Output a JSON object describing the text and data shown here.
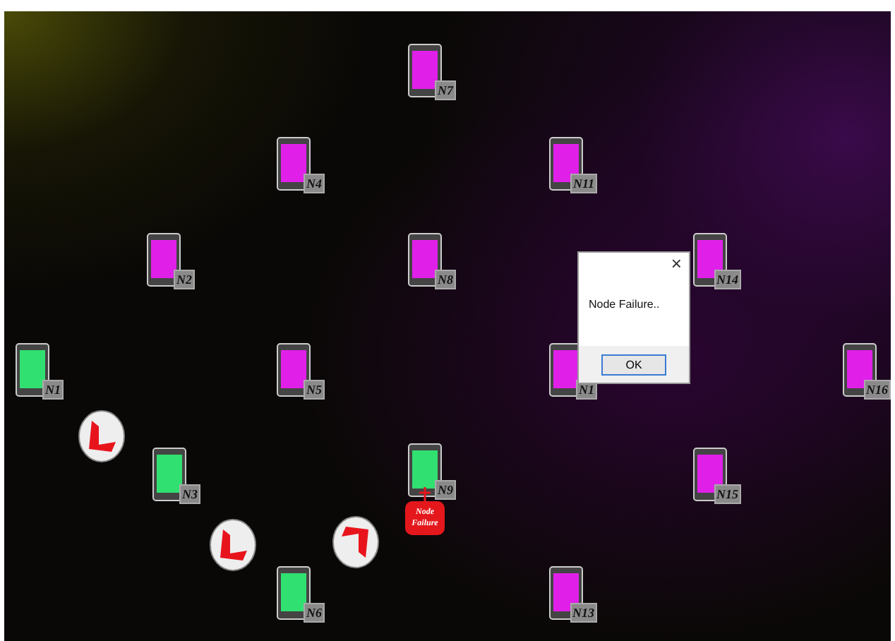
{
  "nodes": [
    {
      "label": "N7",
      "color": "#e020e8"
    },
    {
      "label": "N4",
      "color": "#e020e8"
    },
    {
      "label": "N11",
      "color": "#e020e8"
    },
    {
      "label": "N2",
      "color": "#e020e8"
    },
    {
      "label": "N8",
      "color": "#e020e8"
    },
    {
      "label": "N14",
      "color": "#e020e8"
    },
    {
      "label": "N1",
      "color": "#30e070"
    },
    {
      "label": "N5",
      "color": "#e020e8"
    },
    {
      "label": "N1",
      "color": "#e020e8"
    },
    {
      "label": "N16",
      "color": "#e020e8"
    },
    {
      "label": "N3",
      "color": "#30e070"
    },
    {
      "label": "N9",
      "color": "#30e070"
    },
    {
      "label": "N15",
      "color": "#e020e8"
    },
    {
      "label": "N6",
      "color": "#30e070"
    },
    {
      "label": "N13",
      "color": "#e020e8"
    }
  ],
  "failure_badge": {
    "text": "Node Failure"
  },
  "dialog": {
    "close": "×",
    "message": "Node Failure..",
    "buttons": [
      "OK"
    ]
  }
}
